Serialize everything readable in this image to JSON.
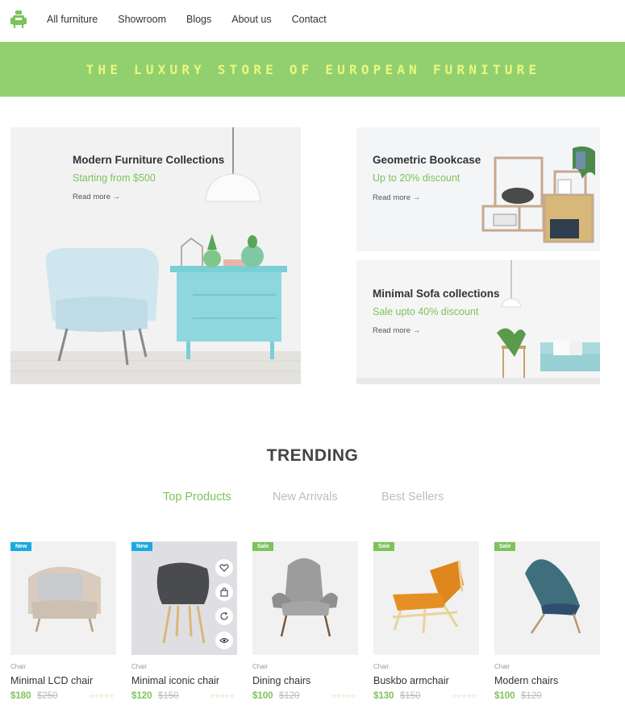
{
  "nav": {
    "logo_icon": "armchair-logo-icon",
    "links": [
      "All furniture",
      "Showroom",
      "Blogs",
      "About us",
      "Contact"
    ]
  },
  "banner": {
    "text": "THE LUXURY STORE OF EUROPEAN FURNITURE"
  },
  "promos": [
    {
      "title": "Modern Furniture Collections",
      "subtitle": "Starting from $500",
      "link": "Read more"
    },
    {
      "title": "Geometric Bookcase",
      "subtitle": "Up to 20% discount",
      "link": "Read more"
    },
    {
      "title": "Minimal Sofa collections",
      "subtitle": "Sale upto 40% discount",
      "link": "Read more"
    }
  ],
  "trending": {
    "heading": "TRENDING",
    "tabs": [
      "Top Products",
      "New Arrivals",
      "Best Sellers"
    ],
    "active_tab": "Top Products"
  },
  "products": [
    {
      "badge": "New",
      "category": "Chair",
      "name": "Minimal LCD chair",
      "price": "$180",
      "old_price": "$250",
      "rating_stars": "☆☆☆☆☆"
    },
    {
      "badge": "New",
      "category": "Chair",
      "name": "Minimal iconic chair",
      "price": "$120",
      "old_price": "$150",
      "rating_stars": "☆☆☆☆☆"
    },
    {
      "badge": "Sale",
      "category": "Chair",
      "name": "Dining chairs",
      "price": "$100",
      "old_price": "$120",
      "rating_stars": "☆☆☆☆☆"
    },
    {
      "badge": "Sale",
      "category": "Chair",
      "name": "Buskbo armchair",
      "price": "$130",
      "old_price": "$150",
      "rating_stars": "☆☆☆☆☆"
    },
    {
      "badge": "Sale",
      "category": "Chair",
      "name": "Modern chairs",
      "price": "$100",
      "old_price": "$120",
      "rating_stars": "☆☆☆☆☆"
    }
  ],
  "product_actions": [
    "heart-icon",
    "shopping-bag-icon",
    "refresh-icon",
    "eye-icon"
  ],
  "colors": {
    "accent": "#7cc35a",
    "banner": "#92d06f",
    "banner_text": "#eaf77f",
    "badge_new": "#1ba9e1"
  }
}
